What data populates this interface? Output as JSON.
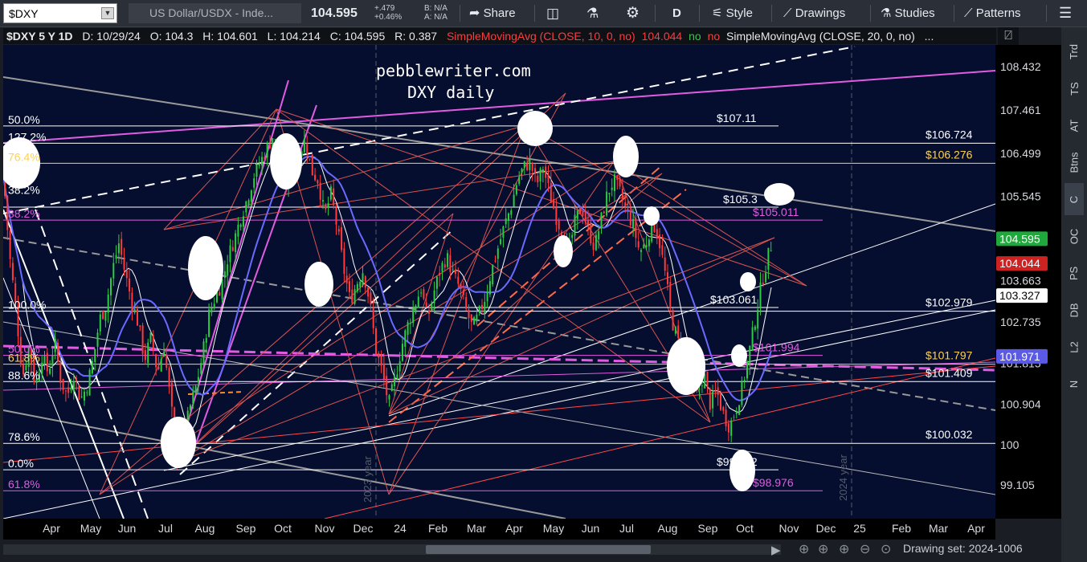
{
  "toolbar": {
    "symbol": "$DXY",
    "description": "US Dollar/USDX - Inde...",
    "last_price": "104.595",
    "change_abs": "+.479",
    "change_pct": "+0.46%",
    "bid": "B: N/A",
    "ask": "A: N/A",
    "share_label": "Share",
    "period_label": "D",
    "style_label": "Style",
    "drawings_label": "Drawings",
    "studies_label": "Studies",
    "patterns_label": "Patterns"
  },
  "header": {
    "title": "$DXY 5 Y 1D",
    "date": "D: 10/29/24",
    "open": "O: 104.3",
    "high": "H: 104.601",
    "low": "L: 104.214",
    "close": "C: 104.595",
    "range": "R: 0.387",
    "sma10_label": "SimpleMovingAvg (CLOSE, 10, 0, no)",
    "sma10_value": "104.044",
    "sma10_no1": "no",
    "sma10_no2": "no",
    "sma20_label": "SimpleMovingAvg (CLOSE, 20, 0, no)",
    "more": "..."
  },
  "colors": {
    "background": "#050e2e",
    "candle_up": "#2ecc40",
    "candle_down": "#ff3b3b",
    "sma_fast": "#ff5a5a",
    "sma_mid": "#e6a817",
    "sma_slow": "#6a6aff",
    "magenta": "#e15ce1",
    "gold": "#ffd24d"
  },
  "chart_data": {
    "type": "candlestick",
    "title": "pebblewriter.com",
    "subtitle": "DXY daily",
    "ylim": [
      98.3,
      108.9
    ],
    "x_tick_labels": [
      "Apr",
      "May",
      "Jun",
      "Jul",
      "Aug",
      "Sep",
      "Oct",
      "Nov",
      "Dec",
      "24",
      "Feb",
      "Mar",
      "Apr",
      "May",
      "Jun",
      "Jul",
      "Aug",
      "Sep",
      "Oct",
      "Nov",
      "Dec",
      "25",
      "Feb",
      "Mar",
      "Apr"
    ],
    "y_tick_labels": [
      "108.432",
      "107.461",
      "106.499",
      "105.545",
      "103.663",
      "102.735",
      "101.815",
      "100.904",
      "100",
      "99.105"
    ],
    "y_tick_values": [
      108.432,
      107.461,
      106.499,
      105.545,
      103.663,
      102.735,
      101.815,
      100.904,
      100,
      99.105
    ],
    "price_badges": [
      {
        "value": "104.595",
        "fill": "#1fa83c",
        "text_color": "#ffffff"
      },
      {
        "value": "104.044",
        "fill": "#cc2222",
        "text_color": "#ffffff"
      },
      {
        "value": "103.327",
        "fill": "#ffffff",
        "text_color": "#000000"
      },
      {
        "value": "101.971",
        "fill": "#5a5ae6",
        "text_color": "#ffffff"
      }
    ],
    "horizontal_levels": [
      {
        "price": 107.11,
        "label": "$107.11",
        "color": "#ffffff",
        "span": "mid"
      },
      {
        "price": 106.724,
        "label": "$106.724",
        "color": "#ffffff",
        "span": "full"
      },
      {
        "price": 106.276,
        "label": "$106.276",
        "color": "#ffd24d",
        "span": "full"
      },
      {
        "price": 105.3,
        "label": "$105.3",
        "color": "#ffffff",
        "span": "mid"
      },
      {
        "price": 105.011,
        "label": "$105.011",
        "color": "#e15ce1",
        "span": "mid"
      },
      {
        "price": 102.979,
        "label": "$102.979",
        "color": "#ffffff",
        "span": "full"
      },
      {
        "price": 103.061,
        "label": "$103.061",
        "color": "#ffffff",
        "span": "mid"
      },
      {
        "price": 101.994,
        "label": "$101.994",
        "color": "#e15ce1",
        "span": "mid"
      },
      {
        "price": 101.797,
        "label": "$101.797",
        "color": "#ffd24d",
        "span": "full"
      },
      {
        "price": 101.409,
        "label": "$101.409",
        "color": "#ffffff",
        "span": "full"
      },
      {
        "price": 100.032,
        "label": "$100.032",
        "color": "#ffffff",
        "span": "full"
      },
      {
        "price": 99.442,
        "label": "$99.442",
        "color": "#ffffff",
        "span": "mid"
      },
      {
        "price": 98.976,
        "label": "$98.976",
        "color": "#e15ce1",
        "span": "mid"
      }
    ],
    "fib_labels": [
      {
        "text": "50.0%",
        "price": 107.11,
        "color": "#ffffff"
      },
      {
        "text": "127.2%",
        "price": 106.724,
        "color": "#ffffff"
      },
      {
        "text": "76.4%",
        "price": 106.276,
        "color": "#ffd24d"
      },
      {
        "text": "38.2%",
        "price": 105.545,
        "color": "#ffffff"
      },
      {
        "text": "38.2%",
        "price": 105.011,
        "color": "#e15ce1"
      },
      {
        "text": "100.0%",
        "price": 102.979,
        "color": "#ffffff"
      },
      {
        "text": "50.0%",
        "price": 101.994,
        "color": "#e15ce1"
      },
      {
        "text": "61.8%",
        "price": 101.797,
        "color": "#ffd24d"
      },
      {
        "text": "88.6%",
        "price": 101.409,
        "color": "#ffffff"
      },
      {
        "text": "78.6%",
        "price": 100.032,
        "color": "#ffffff"
      },
      {
        "text": "0.0%",
        "price": 99.442,
        "color": "#ffffff"
      },
      {
        "text": "61.8%",
        "price": 98.976,
        "color": "#e15ce1"
      }
    ],
    "year_labels": [
      "2023 year",
      "2024 year"
    ],
    "price_path": [
      [
        0,
        106.0
      ],
      [
        8,
        104.2
      ],
      [
        16,
        103.0
      ],
      [
        24,
        101.5
      ],
      [
        32,
        102.2
      ],
      [
        40,
        101.3
      ],
      [
        48,
        102.0
      ],
      [
        56,
        101.6
      ],
      [
        64,
        102.3
      ],
      [
        72,
        101.4
      ],
      [
        80,
        101.1
      ],
      [
        88,
        101.6
      ],
      [
        96,
        101.0
      ],
      [
        104,
        101.3
      ],
      [
        112,
        101.9
      ],
      [
        120,
        102.8
      ],
      [
        128,
        103.1
      ],
      [
        136,
        103.9
      ],
      [
        144,
        104.5
      ],
      [
        152,
        103.8
      ],
      [
        160,
        103.2
      ],
      [
        168,
        102.7
      ],
      [
        176,
        101.9
      ],
      [
        184,
        102.4
      ],
      [
        192,
        101.6
      ],
      [
        200,
        102.2
      ],
      [
        208,
        101.0
      ],
      [
        216,
        99.8
      ],
      [
        224,
        100.1
      ],
      [
        232,
        100.8
      ],
      [
        240,
        101.3
      ],
      [
        248,
        102.0
      ],
      [
        256,
        102.9
      ],
      [
        264,
        103.3
      ],
      [
        272,
        103.6
      ],
      [
        280,
        104.2
      ],
      [
        288,
        104.6
      ],
      [
        296,
        105.1
      ],
      [
        304,
        105.5
      ],
      [
        312,
        106.0
      ],
      [
        320,
        106.3
      ],
      [
        328,
        106.6
      ],
      [
        336,
        106.9
      ],
      [
        344,
        106.4
      ],
      [
        352,
        105.8
      ],
      [
        360,
        106.2
      ],
      [
        368,
        106.5
      ],
      [
        376,
        106.8
      ],
      [
        384,
        106.1
      ],
      [
        392,
        105.9
      ],
      [
        400,
        105.1
      ],
      [
        408,
        105.6
      ],
      [
        416,
        104.8
      ],
      [
        424,
        103.9
      ],
      [
        432,
        103.2
      ],
      [
        440,
        103.6
      ],
      [
        448,
        103.9
      ],
      [
        456,
        103.2
      ],
      [
        464,
        102.1
      ],
      [
        472,
        101.6
      ],
      [
        480,
        100.9
      ],
      [
        488,
        101.5
      ],
      [
        496,
        102.2
      ],
      [
        504,
        102.7
      ],
      [
        512,
        103.1
      ],
      [
        520,
        103.5
      ],
      [
        528,
        102.8
      ],
      [
        536,
        103.4
      ],
      [
        544,
        103.9
      ],
      [
        552,
        104.2
      ],
      [
        560,
        103.8
      ],
      [
        568,
        103.5
      ],
      [
        576,
        103.0
      ],
      [
        584,
        102.6
      ],
      [
        592,
        102.9
      ],
      [
        600,
        103.3
      ],
      [
        608,
        103.9
      ],
      [
        616,
        104.4
      ],
      [
        624,
        104.9
      ],
      [
        632,
        105.3
      ],
      [
        640,
        105.9
      ],
      [
        648,
        106.2
      ],
      [
        656,
        106.3
      ],
      [
        664,
        105.8
      ],
      [
        672,
        106.2
      ],
      [
        680,
        105.6
      ],
      [
        688,
        105.1
      ],
      [
        696,
        104.7
      ],
      [
        704,
        104.3
      ],
      [
        712,
        105.0
      ],
      [
        720,
        105.3
      ],
      [
        728,
        104.8
      ],
      [
        736,
        104.4
      ],
      [
        744,
        105.0
      ],
      [
        752,
        105.6
      ],
      [
        760,
        105.9
      ],
      [
        768,
        105.6
      ],
      [
        776,
        105.2
      ],
      [
        784,
        104.9
      ],
      [
        792,
        104.3
      ],
      [
        800,
        104.5
      ],
      [
        808,
        105.0
      ],
      [
        816,
        104.6
      ],
      [
        824,
        103.8
      ],
      [
        832,
        102.8
      ],
      [
        840,
        102.3
      ],
      [
        848,
        101.8
      ],
      [
        856,
        101.2
      ],
      [
        864,
        101.1
      ],
      [
        872,
        101.6
      ],
      [
        880,
        100.9
      ],
      [
        888,
        101.2
      ],
      [
        896,
        100.7
      ],
      [
        904,
        100.4
      ],
      [
        912,
        100.8
      ],
      [
        920,
        101.3
      ],
      [
        928,
        102.0
      ],
      [
        936,
        102.8
      ],
      [
        944,
        103.6
      ],
      [
        952,
        104.2
      ],
      [
        958,
        104.6
      ]
    ]
  },
  "right_panel": [
    "Trd",
    "TS",
    "AT",
    "Btns",
    "C",
    "OC",
    "PS",
    "DB",
    "L2",
    "N"
  ],
  "status": {
    "drawing_set": "Drawing set: 2024-1006"
  }
}
